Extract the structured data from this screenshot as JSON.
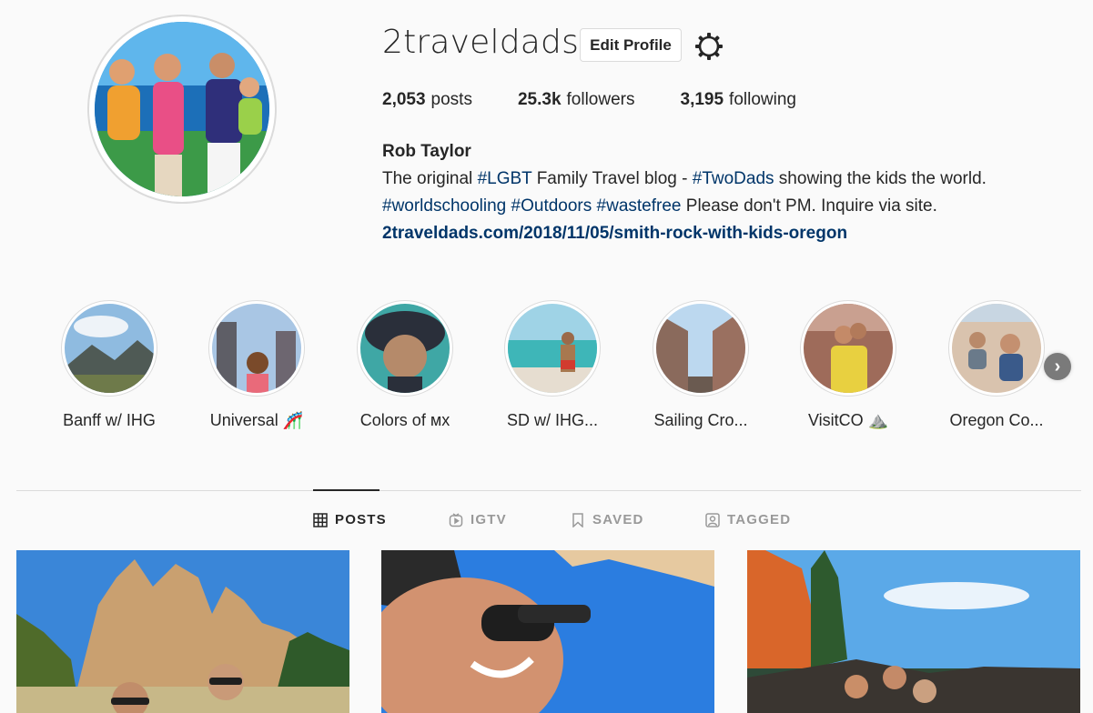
{
  "profile": {
    "username": "2traveldads",
    "edit_button": "Edit Profile",
    "settings_icon": "gear-icon",
    "stats": [
      {
        "value": "2,053",
        "label": "posts"
      },
      {
        "value": "25.3k",
        "label": "followers"
      },
      {
        "value": "3,195",
        "label": "following"
      }
    ],
    "full_name": "Rob Taylor",
    "bio": {
      "line1_a": "The original ",
      "line1_tag1": "#LGBT",
      "line1_b": " Family Travel blog - ",
      "line1_tag2": "#TwoDads",
      "line1_c": " showing the kids the world.",
      "line2_tag1": "#worldschooling",
      "line2_sep1": " ",
      "line2_tag2": "#Outdoors",
      "line2_sep2": " ",
      "line2_tag3": "#wastefree",
      "line2_rest": " Please don't PM. Inquire via site.",
      "link": "2traveldads.com/2018/11/05/smith-rock-with-kids-oregon"
    }
  },
  "highlights": [
    {
      "label": "Banff w/ IHG"
    },
    {
      "label": "Universal 🎢"
    },
    {
      "label": "Colors of мх"
    },
    {
      "label": "SD w/ IHG..."
    },
    {
      "label": "Sailing Cro..."
    },
    {
      "label": "VisitCO ⛰️"
    },
    {
      "label": "Oregon Co..."
    }
  ],
  "highlights_next_icon": "chevron-right-icon",
  "tabs": [
    {
      "label": "POSTS",
      "icon": "grid-icon",
      "active": true
    },
    {
      "label": "IGTV",
      "icon": "tv-icon",
      "active": false
    },
    {
      "label": "SAVED",
      "icon": "bookmark-icon",
      "active": false
    },
    {
      "label": "TAGGED",
      "icon": "tagged-person-icon",
      "active": false
    }
  ],
  "colors": {
    "background": "#fafafa",
    "text": "#262626",
    "hashtag": "#003569",
    "border": "#dbdbdb",
    "muted": "#999999"
  }
}
